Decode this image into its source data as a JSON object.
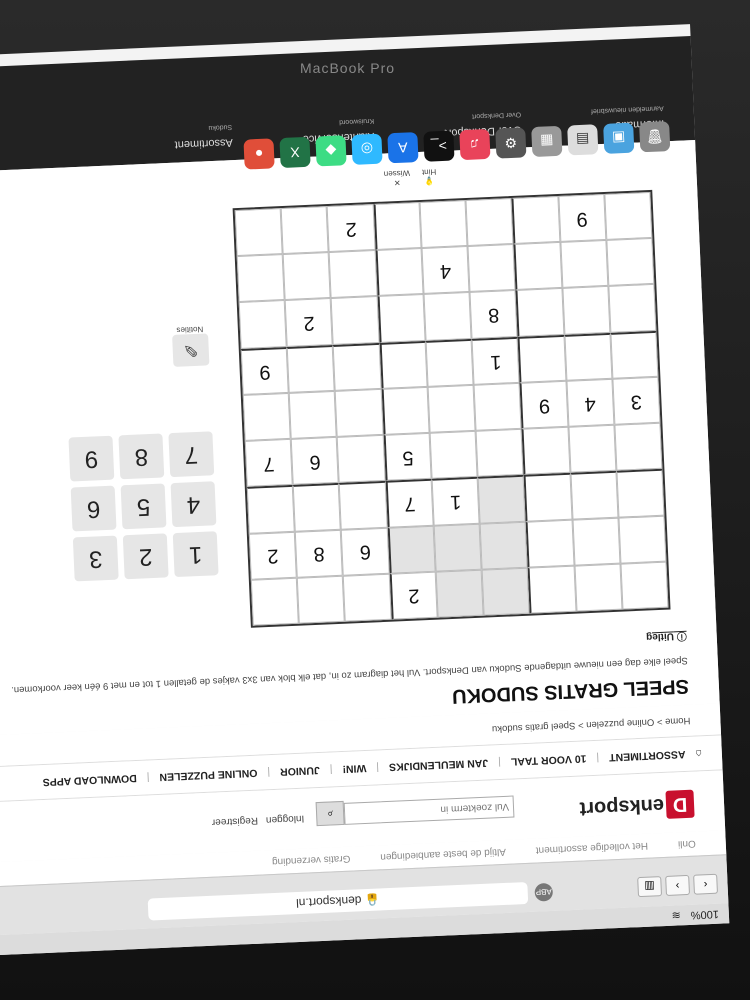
{
  "browser": {
    "url": "denksport.nl",
    "battery": "100%",
    "abp": "ABP",
    "nav_back": "‹",
    "nav_forward": "›"
  },
  "site": {
    "topbar": [
      "Gratis verzending",
      "Altijd de beste aanbiedingen",
      "Het volledige assortiment",
      "Onli"
    ],
    "logo_letter": "D",
    "logo_text": "enksport",
    "search_placeholder": "Vul zoekterm in",
    "login": "Inloggen",
    "register": "Registreer",
    "nav": [
      "ASSORTIMENT",
      "10 VOOR TAAL",
      "JAN MEULENDIJKS",
      "WIN!",
      "JUNIOR",
      "ONLINE PUZZELEN",
      "DOWNLOAD APPS"
    ],
    "breadcrumb": "Home > Online puzzelen > Speel gratis sudoku",
    "title": "SPEEL GRATIS SUDOKU",
    "intro": "Speel elke dag een nieuwe uitdagende Sudoku van Denksport. Vul het diagram zo in, dat elk blok van 3x3 vakjes de getallen 1 tot en met 9 één keer voorkomen.",
    "uitleg": "Uitleg"
  },
  "sudoku": {
    "rows": [
      [
        "",
        "",
        "",
        "",
        "",
        "2",
        "",
        "",
        ""
      ],
      [
        "",
        "",
        "",
        "",
        "",
        "",
        "6",
        "8",
        "2"
      ],
      [
        "",
        "",
        "",
        "",
        "1",
        "7",
        "",
        "",
        ""
      ],
      [
        "",
        "",
        "",
        "",
        "",
        "5",
        "",
        "6",
        "7"
      ],
      [
        "3",
        "4",
        "9",
        "",
        "",
        "",
        "",
        "",
        ""
      ],
      [
        "",
        "",
        "",
        "1",
        "",
        "",
        "",
        "",
        "9"
      ],
      [
        "",
        "",
        "",
        "8",
        "",
        "",
        "",
        "2",
        ""
      ],
      [
        "",
        "",
        "",
        "",
        "4",
        "",
        "",
        "",
        ""
      ],
      [
        "",
        "9",
        "",
        "",
        "",
        "",
        "2",
        "",
        ""
      ]
    ],
    "selected_block": "top-center"
  },
  "pad": [
    "1",
    "2",
    "3",
    "4",
    "5",
    "6",
    "7",
    "8",
    "9"
  ],
  "notities": "Notities",
  "actions": {
    "wissen": "Wissen",
    "hint": "Hint"
  },
  "footer": {
    "col1": "Assortiment",
    "col1_sub": "Sudoku",
    "col2": "Klantenservice",
    "col2_sub": "Kruiswoord",
    "col3": "Over Denksport",
    "col3_sub": "Over Denksport",
    "col4": "Informatie",
    "col4_sub": "Aanmelden nieuwsbrief"
  },
  "device_brand": "MacBook Pro"
}
